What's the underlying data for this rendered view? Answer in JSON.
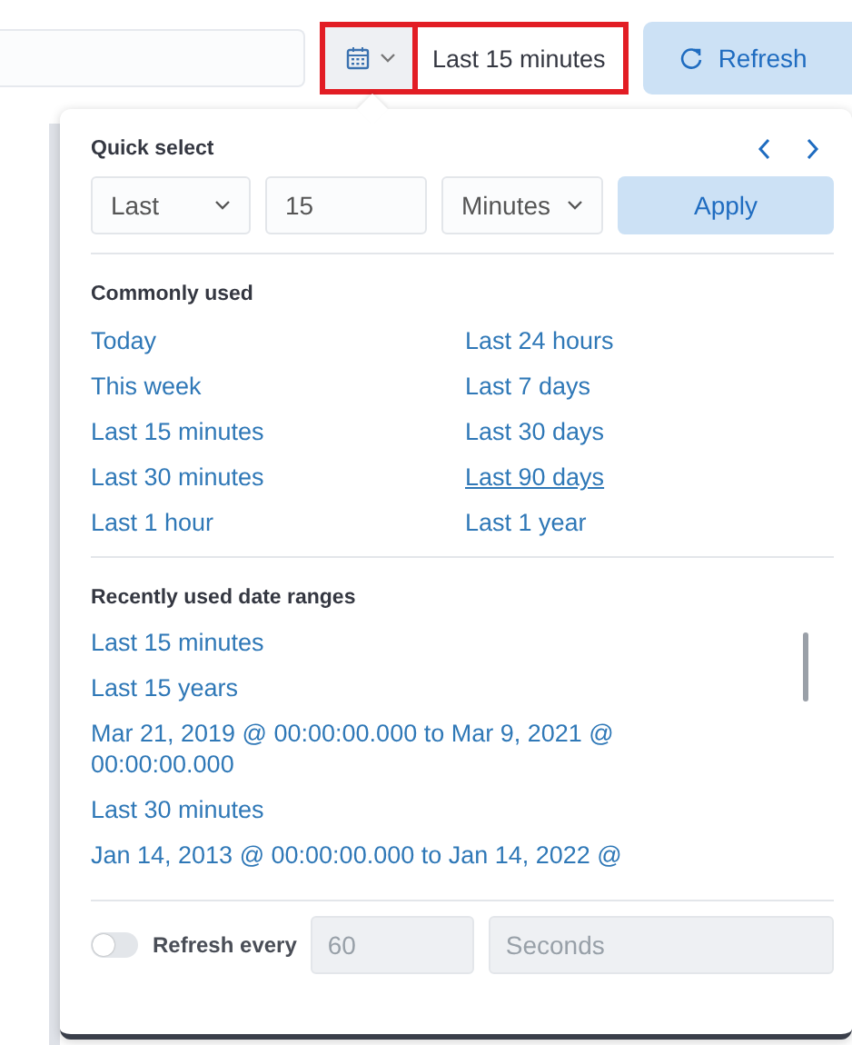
{
  "top_bar": {
    "date_picker": {
      "highlighted": true,
      "value": "Last 15 minutes"
    },
    "refresh_button": {
      "label": "Refresh"
    }
  },
  "quick_select": {
    "title": "Quick select",
    "direction": "Last",
    "amount": "15",
    "unit": "Minutes",
    "apply_button": "Apply"
  },
  "commonly_used": {
    "title": "Commonly used",
    "items": [
      {
        "label": "Today",
        "hovered": false
      },
      {
        "label": "Last 24 hours",
        "hovered": false
      },
      {
        "label": "This week",
        "hovered": false
      },
      {
        "label": "Last 7 days",
        "hovered": false
      },
      {
        "label": "Last 15 minutes",
        "hovered": false
      },
      {
        "label": "Last 30 days",
        "hovered": false
      },
      {
        "label": "Last 30 minutes",
        "hovered": false
      },
      {
        "label": "Last 90 days",
        "hovered": true
      },
      {
        "label": "Last 1 hour",
        "hovered": false
      },
      {
        "label": "Last 1 year",
        "hovered": false
      }
    ]
  },
  "recently_used": {
    "title": "Recently used date ranges",
    "items": [
      "Last 15 minutes",
      "Last 15 years",
      "Mar 21, 2019 @ 00:00:00.000 to Mar 9, 2021 @ 00:00:00.000",
      "Last 30 minutes",
      "Jan 14, 2013 @ 00:00:00.000 to Jan 14, 2022 @"
    ]
  },
  "refresh_interval": {
    "on": false,
    "label": "Refresh every",
    "value": "60",
    "unit": "Seconds",
    "disabled": true
  }
}
